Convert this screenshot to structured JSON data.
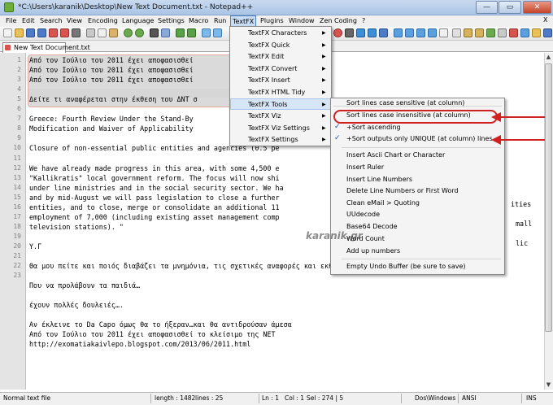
{
  "window": {
    "title": "*C:\\Users\\karanik\\Desktop\\New Text Document.txt - Notepad++",
    "minimize_glyph": "—",
    "maximize_glyph": "▭",
    "close_glyph": "✕"
  },
  "menubar": {
    "items": [
      "File",
      "Edit",
      "Search",
      "View",
      "Encoding",
      "Language",
      "Settings",
      "Macro",
      "Run",
      "TextFX",
      "Plugins",
      "Window",
      "Zen Coding",
      "?"
    ],
    "close_glyph": "X"
  },
  "tab": {
    "label": "New Text Document.txt"
  },
  "editor": {
    "line_numbers": [
      "1",
      "2",
      "3",
      "4",
      "5",
      "6",
      "7",
      "8",
      "9",
      "10",
      "11",
      "12",
      "13",
      "14",
      "15",
      "16",
      "17",
      "18",
      "19",
      "20",
      "21",
      "22",
      "23"
    ],
    "lines": [
      "Από τον Ιούλιο του 2011 έχει αποφασισθεί",
      "Από τον Ιούλιο του 2011 έχει αποφασισθεί",
      "Από τον Ιούλιο του 2011 έχει αποφασισθεί",
      "",
      "Δείτε τι αναφέρεται στην έκθεση του ΔΝΤ σ",
      "",
      "Greece: Fourth Review Under the Stand-By",
      "Modification and Waiver of Applicability",
      "",
      "Closure of non-essential public entities and agencies (0.5 pe",
      "",
      "We have already made progress in this area, with some 4,500 e",
      "\"Kallikratis\" local government reform. The focus will now shi",
      "under line ministries and in the social security sector. We ha",
      "and by mid-August we will pass legislation to close a further",
      "entities, and to close, merge or consolidate an additional 11",
      "employment of 7,000 (including existing asset management comp",
      "television stations). \"",
      "",
      "Υ.Γ",
      "",
      "Θα μου πείτε και ποιός διαβάζει τα μνημόνια, τις σχετικές αναφορές και εκθέσεις της τρόικας…;;",
      "",
      "Που να προλάβουν τα παιδιά…",
      "",
      "έχουν πολλές δουλειές….",
      "",
      "Αν έκλεινε το Da Capo όμως θα το ήξεραν…και θα αντιδρούσαν άμεσα",
      "Από τον Ιούλιο του 2011 έχει αποφασισθεί το κλείσιμο της ΝΕΤ",
      "http://exomatiakaivlepo.blogspot.com/2013/06/2011.html"
    ],
    "right_fragments": [
      "ities",
      "mall",
      "lic"
    ]
  },
  "textfx_menu": {
    "items": [
      {
        "label": "TextFX Characters"
      },
      {
        "label": "TextFX Quick"
      },
      {
        "label": "TextFX Edit"
      },
      {
        "label": "TextFX Convert"
      },
      {
        "label": "TextFX Insert"
      },
      {
        "label": "TextFX HTML Tidy"
      },
      {
        "label": "TextFX Tools"
      },
      {
        "label": "TextFX Viz"
      },
      {
        "label": "TextFX Viz Settings"
      },
      {
        "label": "TextFX Settings"
      }
    ],
    "arrow_glyph": "▶"
  },
  "tools_submenu": {
    "items": [
      "Sort lines case sensitive (at column)",
      "Sort lines case insensitive (at column)",
      "+Sort ascending",
      "+Sort outputs only UNIQUE (at column) lines",
      "Insert Ascii Chart or Character",
      "Insert Ruler",
      "Insert Line Numbers",
      "Delete Line Numbers or First Word",
      "Clean eMail > Quoting",
      "UUdecode",
      "Base64 Decode",
      "Word Count",
      "Add up numbers",
      "Empty Undo Buffer (be sure to save)"
    ],
    "check_glyph": "✓"
  },
  "watermark": "karanik.gr",
  "statusbar": {
    "file_type": "Normal text file",
    "length": "length : 1482",
    "lines": "lines : 25",
    "ln": "Ln : 1",
    "col": "Col : 1",
    "sel": "Sel : 274 | 5",
    "eol": "Dos\\Windows",
    "encoding": "ANSI",
    "mode": "INS"
  },
  "colors": {
    "annotation_red": "#d02020",
    "accent": "#4a7fc1"
  }
}
